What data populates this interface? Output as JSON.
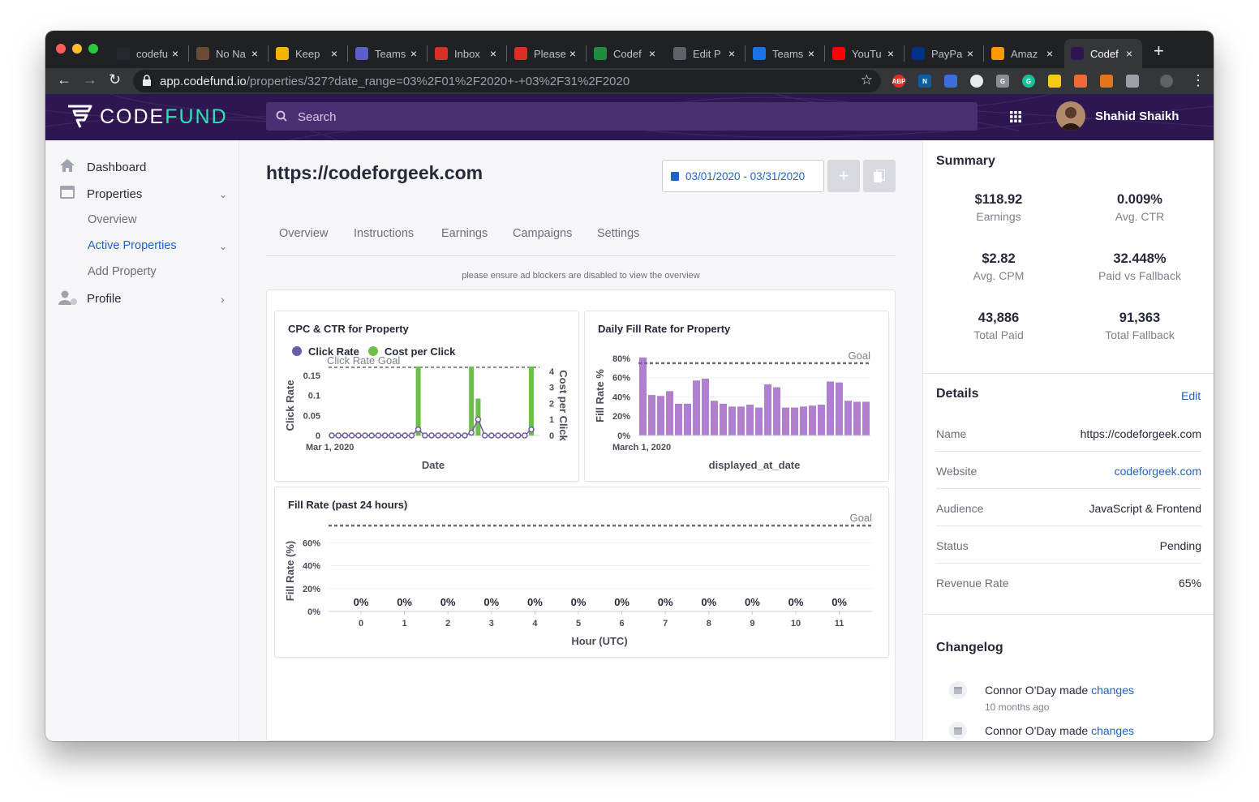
{
  "browser": {
    "tabs": [
      {
        "title": "codefu",
        "color": "#24292e",
        "icon": "github-icon"
      },
      {
        "title": "No Na",
        "color": "#6a4b33",
        "icon": "notion-icon"
      },
      {
        "title": "Keep",
        "color": "#f4b400",
        "icon": "keep-icon"
      },
      {
        "title": "Teams",
        "color": "#5b5fc7",
        "icon": "teams-icon"
      },
      {
        "title": "Inbox",
        "color": "#d93025",
        "icon": "gmail-icon"
      },
      {
        "title": "Please",
        "color": "#d93025",
        "icon": "gmail-icon"
      },
      {
        "title": "Codef",
        "color": "#1e8e3e",
        "icon": "sheets-icon"
      },
      {
        "title": "Edit P",
        "color": "#5f6368",
        "icon": "wordpress-icon"
      },
      {
        "title": "Teams",
        "color": "#1a73e8",
        "icon": "teams-icon"
      },
      {
        "title": "YouTu",
        "color": "#ff0000",
        "icon": "youtube-icon"
      },
      {
        "title": "PayPa",
        "color": "#003087",
        "icon": "paypal-icon"
      },
      {
        "title": "Amaz",
        "color": "#ff9900",
        "icon": "amazon-icon"
      },
      {
        "title": "Codef",
        "color": "#2e1650",
        "icon": "codefund-icon"
      }
    ],
    "url_host": "app.codefund.io",
    "url_path": "/properties/327?date_range=03%2F01%2F2020+-+03%2F31%2F2020"
  },
  "app": {
    "logo_text_a": "CODE",
    "logo_text_b": "FUND",
    "search_placeholder": "Search",
    "user_name": "Shahid Shaikh"
  },
  "sidebar": {
    "dashboard": "Dashboard",
    "properties": "Properties",
    "overview": "Overview",
    "active_properties": "Active Properties",
    "add_property": "Add Property",
    "profile": "Profile"
  },
  "page": {
    "title": "https://codeforgeek.com",
    "date_range": "03/01/2020 - 03/31/2020",
    "tabs": [
      "Overview",
      "Instructions",
      "Earnings",
      "Campaigns",
      "Settings"
    ],
    "notice": "please ensure ad blockers are disabled to view the overview"
  },
  "chart_data": [
    {
      "type": "bar+line",
      "title": "CPC & CTR for Property",
      "legend": [
        "Click Rate",
        "Cost per Click"
      ],
      "xlabel": "Date",
      "ylabel": "Click Rate",
      "y2label": "Cost per Click",
      "goal_label": "Click Rate Goal",
      "x_tick": "Mar 1, 2020",
      "y_ticks": [
        "0",
        "0.05",
        "0.1",
        "0.15"
      ],
      "y2_ticks": [
        "0",
        "1",
        "2",
        "3",
        "4"
      ],
      "ylim": [
        0,
        0.18
      ],
      "y2lim": [
        0,
        4.5
      ],
      "goal": 0.17,
      "click_rate": [
        0,
        0,
        0,
        0,
        0,
        0,
        0,
        0,
        0,
        0,
        0,
        0,
        0,
        0.015,
        0,
        0,
        0,
        0,
        0,
        0,
        0,
        0.007,
        0.04,
        0,
        0,
        0,
        0,
        0,
        0,
        0,
        0.015
      ],
      "cpc": [
        0,
        0,
        0,
        0,
        0,
        0,
        0,
        0,
        0,
        0,
        0,
        0,
        0,
        4.3,
        0,
        0,
        0,
        0,
        0,
        0,
        0,
        4.3,
        2.3,
        0,
        0,
        0,
        0,
        0,
        0,
        0,
        4.3
      ],
      "colors": {
        "click_rate": "#6f5aa8",
        "cpc": "#6cc04a"
      }
    },
    {
      "type": "bar",
      "title": "Daily Fill Rate for Property",
      "xlabel": "displayed_at_date",
      "ylabel": "Fill Rate %",
      "x_tick": "March 1, 2020",
      "y_ticks": [
        "0%",
        "20%",
        "40%",
        "60%",
        "80%"
      ],
      "ylim": [
        0,
        85
      ],
      "goal": 75,
      "goal_label": "Goal",
      "values": [
        81,
        42,
        41,
        46,
        33,
        33,
        57,
        59,
        36,
        33,
        30,
        30,
        32,
        29,
        53,
        50,
        29,
        29,
        30,
        31,
        32,
        56,
        55,
        36,
        35,
        35
      ],
      "color": "#b07fd0"
    },
    {
      "type": "bar",
      "title": "Fill Rate (past 24 hours)",
      "xlabel": "Hour (UTC)",
      "ylabel": "Fill Rate (%)",
      "categories": [
        "0",
        "1",
        "2",
        "3",
        "4",
        "5",
        "6",
        "7",
        "8",
        "9",
        "10",
        "11"
      ],
      "values": [
        0,
        0,
        0,
        0,
        0,
        0,
        0,
        0,
        0,
        0,
        0,
        0
      ],
      "data_labels": [
        "0%",
        "0%",
        "0%",
        "0%",
        "0%",
        "0%",
        "0%",
        "0%",
        "0%",
        "0%",
        "0%",
        "0%"
      ],
      "y_ticks": [
        "0%",
        "20%",
        "40%",
        "60%"
      ],
      "ylim": [
        0,
        80
      ],
      "goal": 75,
      "goal_label": "Goal"
    }
  ],
  "summary": {
    "heading": "Summary",
    "stats": [
      {
        "value": "$118.92",
        "label": "Earnings"
      },
      {
        "value": "0.009%",
        "label": "Avg. CTR"
      },
      {
        "value": "$2.82",
        "label": "Avg. CPM"
      },
      {
        "value": "32.448%",
        "label": "Paid vs Fallback"
      },
      {
        "value": "43,886",
        "label": "Total Paid"
      },
      {
        "value": "91,363",
        "label": "Total Fallback"
      }
    ]
  },
  "details": {
    "heading": "Details",
    "edit": "Edit",
    "rows": [
      {
        "key": "Name",
        "value": "https://codeforgeek.com"
      },
      {
        "key": "Website",
        "value": "codeforgeek.com"
      },
      {
        "key": "Audience",
        "value": "JavaScript & Frontend"
      },
      {
        "key": "Status",
        "value": "Pending"
      },
      {
        "key": "Revenue Rate",
        "value": "65%"
      }
    ]
  },
  "changelog": {
    "heading": "Changelog",
    "entries": [
      {
        "text": "Connor O'Day made ",
        "link": "changes",
        "ago": "10 months ago"
      },
      {
        "text": "Connor O'Day made ",
        "link": "changes",
        "ago": ""
      }
    ]
  }
}
